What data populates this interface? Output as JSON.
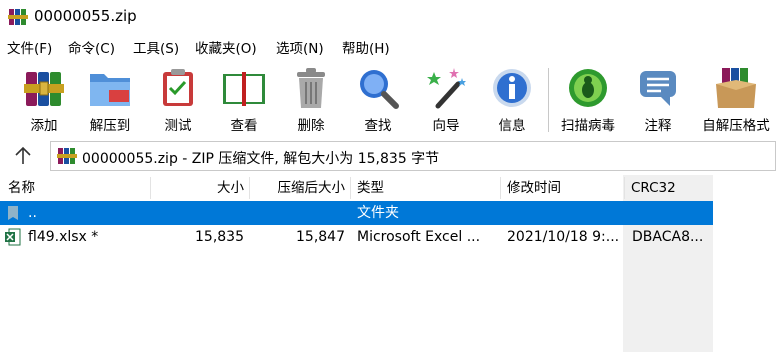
{
  "window": {
    "title": "00000055.zip"
  },
  "menu": [
    {
      "label": "文件(F)"
    },
    {
      "label": "命令(C)"
    },
    {
      "label": "工具(S)"
    },
    {
      "label": "收藏夹(O)"
    },
    {
      "label": "选项(N)"
    },
    {
      "label": "帮助(H)"
    }
  ],
  "toolbar": [
    {
      "label": "添加",
      "icon": "add-archive-icon"
    },
    {
      "label": "解压到",
      "icon": "extract-folder-icon"
    },
    {
      "label": "测试",
      "icon": "test-clipboard-icon"
    },
    {
      "label": "查看",
      "icon": "view-book-icon"
    },
    {
      "label": "删除",
      "icon": "trash-icon"
    },
    {
      "label": "查找",
      "icon": "magnifier-icon"
    },
    {
      "label": "向导",
      "icon": "wizard-wand-icon"
    },
    {
      "label": "信息",
      "icon": "info-icon"
    },
    {
      "label": "扫描病毒",
      "icon": "virus-scan-icon"
    },
    {
      "label": "注释",
      "icon": "comment-icon"
    },
    {
      "label": "自解压格式",
      "icon": "sfx-box-icon"
    }
  ],
  "address": {
    "text": "00000055.zip - ZIP 压缩文件, 解包大小为 15,835 字节"
  },
  "columns": [
    {
      "label": "名称"
    },
    {
      "label": "大小"
    },
    {
      "label": "压缩后大小"
    },
    {
      "label": "类型"
    },
    {
      "label": "修改时间"
    },
    {
      "label": "CRC32"
    }
  ],
  "rows": [
    {
      "name": "..",
      "size": "",
      "packed": "",
      "type": "文件夹",
      "modified": "",
      "crc": "",
      "selected": true
    },
    {
      "name": "fl49.xlsx *",
      "size": "15,835",
      "packed": "15,847",
      "type": "Microsoft Excel ...",
      "modified": "2021/10/18 9:...",
      "crc": "DBACA8...",
      "selected": false
    }
  ],
  "colors": {
    "selection": "#0078d7",
    "crc_column": "#f0f0f0"
  }
}
